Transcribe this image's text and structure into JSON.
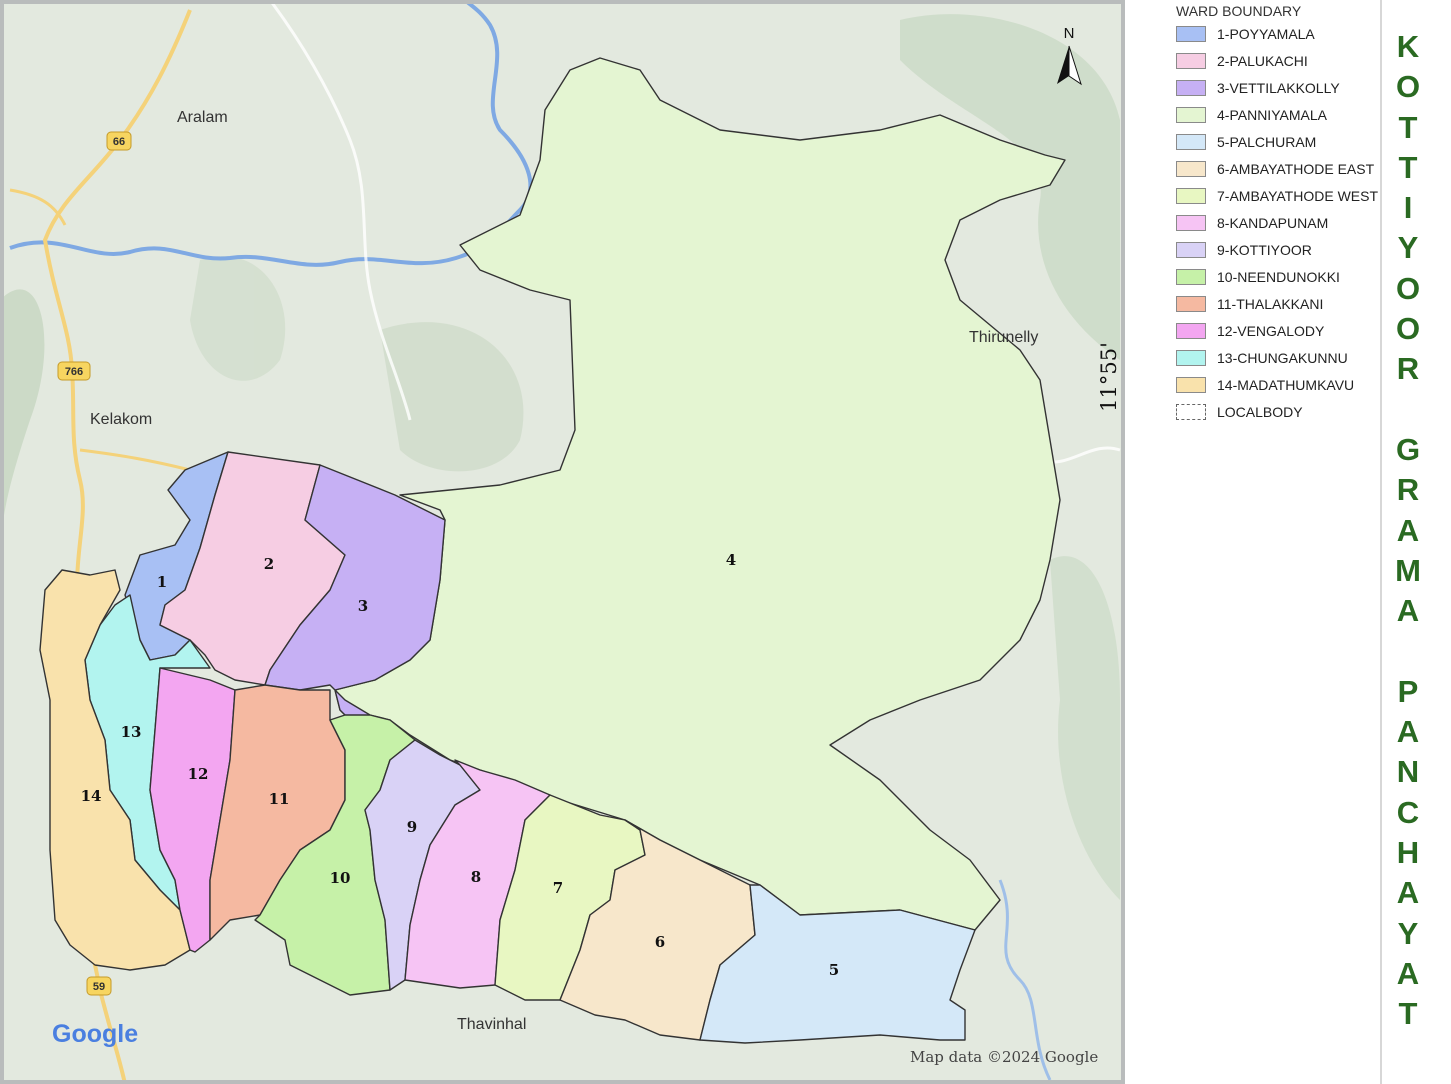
{
  "map": {
    "wards": [
      {
        "number": "1",
        "name": "1-POYYAMALA",
        "color": "#a8c0f4"
      },
      {
        "number": "2",
        "name": "2-PALUKACHI",
        "color": "#f6cde3"
      },
      {
        "number": "3",
        "name": "3-VETTILAKKOLLY",
        "color": "#c6b0f4"
      },
      {
        "number": "4",
        "name": "4-PANNIYAMALA",
        "color": "#e4f5d2"
      },
      {
        "number": "5",
        "name": "5-PALCHURAM",
        "color": "#d4e8f8"
      },
      {
        "number": "6",
        "name": "6-AMBAYATHODE EAST",
        "color": "#f7e7cb"
      },
      {
        "number": "7",
        "name": "7-AMBAYATHODE WEST",
        "color": "#e8f7c2"
      },
      {
        "number": "8",
        "name": "8-KANDAPUNAM",
        "color": "#f6c4f4"
      },
      {
        "number": "9",
        "name": "9-KOTTIYOOR",
        "color": "#d9d2f6"
      },
      {
        "number": "10",
        "name": "10-NEENDUNOKKI",
        "color": "#c6f1a8"
      },
      {
        "number": "11",
        "name": "11-THALAKKANI",
        "color": "#f5b9a1"
      },
      {
        "number": "12",
        "name": "12-VENGALODY",
        "color": "#f3a6f1"
      },
      {
        "number": "13",
        "name": "13-CHUNGAKUNNU",
        "color": "#b2f4ef"
      },
      {
        "number": "14",
        "name": "14-MADATHUMKAVU",
        "color": "#f9e2ac"
      }
    ],
    "places": {
      "aralam": "Aralam",
      "kelakom": "Kelakom",
      "thirunelly": "Thirunelly",
      "thavinhal": "Thavinhal"
    },
    "road_shields": {
      "road_66": "66",
      "road_766": "766",
      "road_59": "59"
    },
    "north_label": "N",
    "credit": "Map data ©2024 Google",
    "google_logo": "Google",
    "latitude_label": "11°55'"
  },
  "legend": {
    "title": "WARD BOUNDARY",
    "localbody_label": "LOCALBODY"
  },
  "title": {
    "chars": [
      "K",
      "O",
      "T",
      "T",
      "I",
      "Y",
      "O",
      "O",
      "R",
      "",
      "G",
      "R",
      "A",
      "M",
      "A",
      "",
      "P",
      "A",
      "N",
      "C",
      "H",
      "A",
      "Y",
      "A",
      "T"
    ]
  },
  "colors": {
    "title_green": "#2a6a22",
    "boundary": "#333333",
    "river": "#7fa9e3",
    "road": "#f4d27a"
  }
}
